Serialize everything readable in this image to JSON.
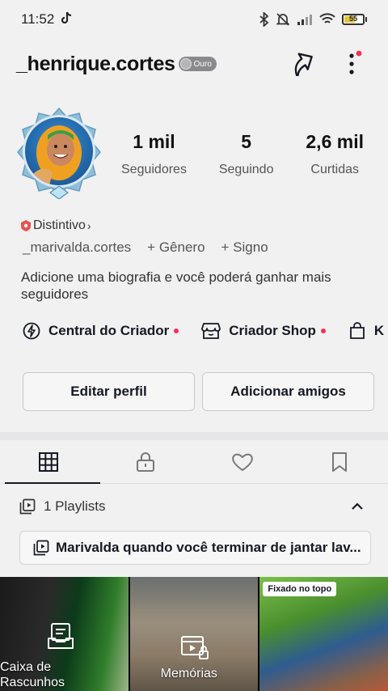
{
  "status_bar": {
    "time": "11:52",
    "app_indicator": "tiktok-icon",
    "battery_level": "55",
    "icons": [
      "bluetooth-icon",
      "mute-icon",
      "signal-icon",
      "wifi-icon",
      "battery-icon"
    ]
  },
  "header": {
    "username": "_henrique.cortes",
    "badge": "Ouro",
    "icons": [
      "share-icon",
      "more-icon"
    ],
    "notification_color": "#fe2c55"
  },
  "profile": {
    "stats": [
      {
        "value": "1 mil",
        "label": "Seguidores"
      },
      {
        "value": "5",
        "label": "Seguindo"
      },
      {
        "value": "2,6 mil",
        "label": "Curtidas"
      }
    ],
    "distintivo": "Distintivo",
    "handle": "_marivalda.cortes",
    "gender": "+ Gênero",
    "sign": "+ Signo",
    "bio": "Adicione uma biografia e você poderá ganhar mais seguidores"
  },
  "creator_links": [
    {
      "label": "Central do Criador",
      "icon": "bolt-icon"
    },
    {
      "label": "Criador Shop",
      "icon": "shop-icon"
    },
    {
      "label": "K",
      "icon": "bag-icon"
    }
  ],
  "buttons": {
    "edit": "Editar perfil",
    "add_friends": "Adicionar amigos"
  },
  "tabs": [
    {
      "icon": "grid-icon",
      "active": true
    },
    {
      "icon": "lock-icon",
      "active": false
    },
    {
      "icon": "heart-icon",
      "active": false
    },
    {
      "icon": "bookmark-icon",
      "active": false
    }
  ],
  "playlists": {
    "header": "1 Playlists",
    "items": [
      "Marivalda quando você terminar de jantar lav..."
    ]
  },
  "grid": {
    "cells": [
      {
        "label": "Caixa de Rascunhos"
      },
      {
        "label": "Memórias"
      },
      {
        "pinned": "Fixado no topo"
      }
    ]
  },
  "colors": {
    "accent": "#fe2c55",
    "background": "#f1f1f2",
    "text": "#161823"
  }
}
